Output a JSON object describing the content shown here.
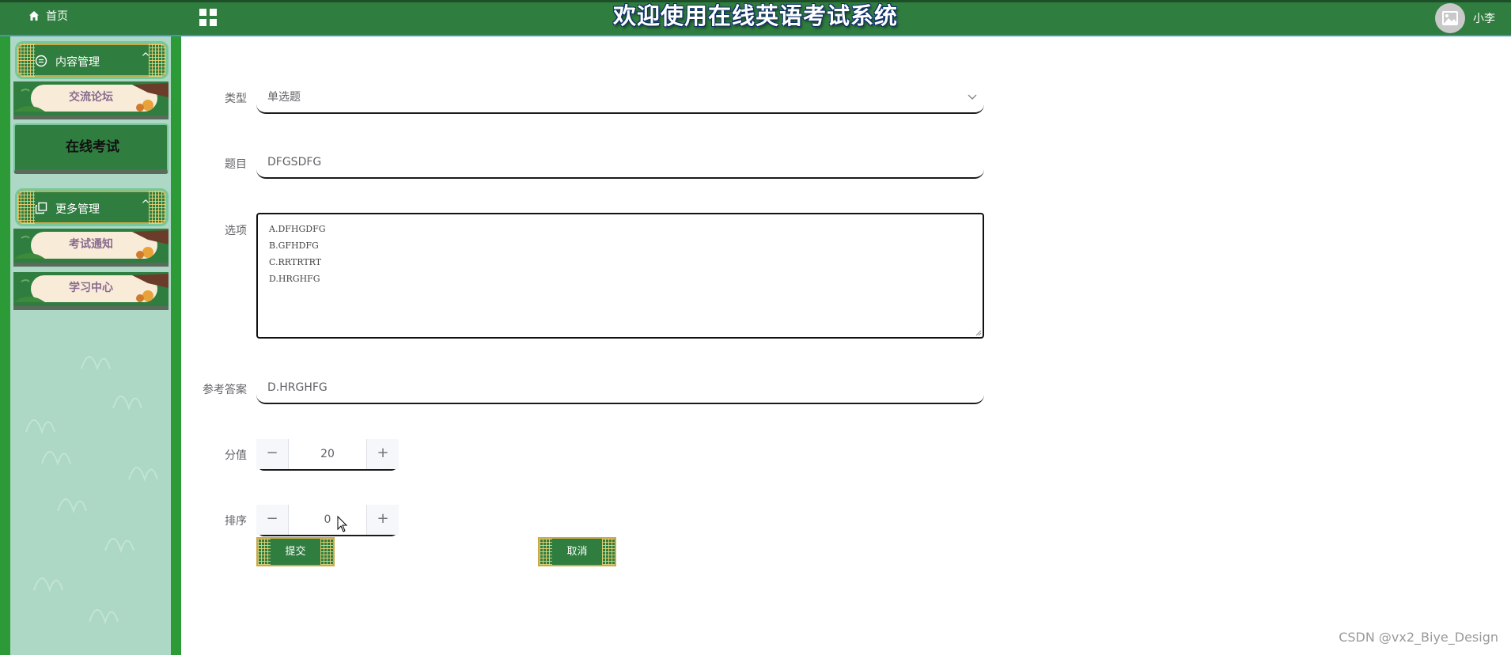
{
  "header": {
    "home_label": "首页",
    "title": "欢迎使用在线英语考试系统",
    "username": "小李"
  },
  "sidebar": {
    "groups": [
      {
        "label": "内容管理",
        "icon": "message-icon",
        "expanded": true,
        "items": [
          {
            "label": "交流论坛",
            "active": false
          },
          {
            "label": "在线考试",
            "active": true
          }
        ]
      },
      {
        "label": "更多管理",
        "icon": "copy-icon",
        "expanded": true,
        "items": [
          {
            "label": "考试通知",
            "active": false
          },
          {
            "label": "学习中心",
            "active": false
          }
        ]
      }
    ]
  },
  "form": {
    "type": {
      "label": "类型",
      "value": "单选题"
    },
    "question": {
      "label": "题目",
      "value": "DFGSDFG"
    },
    "options": {
      "label": "选项",
      "lines": [
        "A.DFHGDFG",
        "B.GFHDFG",
        "C.RRTRTRT",
        "D.HRGHFG"
      ]
    },
    "answer": {
      "label": "参考答案",
      "value": "D.HRGHFG"
    },
    "score": {
      "label": "分值",
      "value": "20"
    },
    "order": {
      "label": "排序",
      "value": "0"
    },
    "submit_label": "提交",
    "cancel_label": "取消"
  },
  "watermark": "CSDN @vx2_Biye_Design",
  "colors": {
    "header_bg": "#2f7d3f",
    "sidebar_bg": "#2d9a38",
    "sidebar_inner": "#acd8c5",
    "button_bg": "#2f7d3f",
    "button_border": "#c9a94b"
  }
}
